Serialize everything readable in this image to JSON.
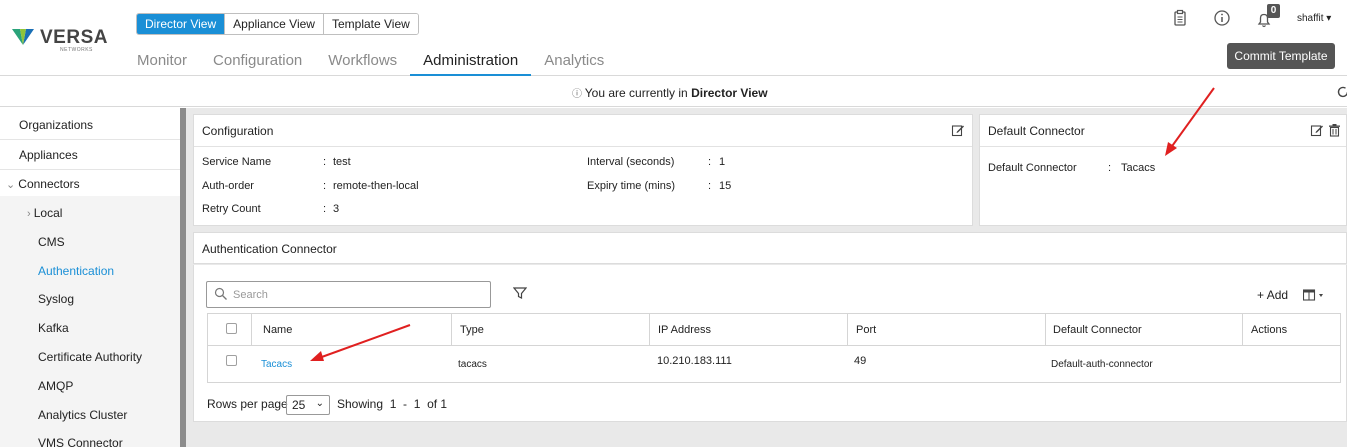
{
  "header": {
    "logo": {
      "brand": "VERSA",
      "sub": "NETWORKS"
    },
    "view_toggle": [
      "Director View",
      "Appliance View",
      "Template View"
    ],
    "active_view": "Director View",
    "nav": [
      "Monitor",
      "Configuration",
      "Workflows",
      "Administration",
      "Analytics"
    ],
    "active_nav": "Administration",
    "notification_count": "0",
    "user": "shaffit",
    "commit_button": "Commit Template",
    "icons": [
      "clipboard-icon",
      "info-icon",
      "bell-icon"
    ]
  },
  "banner": {
    "prefix": "You are currently in ",
    "view": "Director View"
  },
  "sidebar": {
    "items": [
      {
        "label": "Organizations"
      },
      {
        "label": "Appliances"
      },
      {
        "label": "Connectors",
        "expanded": true
      },
      {
        "label": "Local",
        "child": true,
        "collapsed": true
      },
      {
        "label": "CMS",
        "child": true
      },
      {
        "label": "Authentication",
        "child": true,
        "active": true
      },
      {
        "label": "Syslog",
        "child": true
      },
      {
        "label": "Kafka",
        "child": true
      },
      {
        "label": "Certificate Authority",
        "child": true
      },
      {
        "label": "AMQP",
        "child": true
      },
      {
        "label": "Analytics Cluster",
        "child": true
      },
      {
        "label": "VMS Connector",
        "child": true
      }
    ]
  },
  "configuration": {
    "title": "Configuration",
    "left": [
      {
        "label": "Service Name",
        "value": "test"
      },
      {
        "label": "Auth-order",
        "value": "remote-then-local"
      },
      {
        "label": "Retry Count",
        "value": "3"
      }
    ],
    "right": [
      {
        "label": "Interval (seconds)",
        "value": "1"
      },
      {
        "label": "Expiry time (mins)",
        "value": "15"
      }
    ]
  },
  "default_connector": {
    "title": "Default Connector",
    "label": "Default Connector",
    "value": "Tacacs"
  },
  "auth_connector": {
    "title": "Authentication Connector",
    "search_placeholder": "Search",
    "add_label": "Add",
    "columns": [
      "Name",
      "Type",
      "IP Address",
      "Port",
      "Default Connector",
      "Actions"
    ],
    "rows": [
      {
        "name": "Tacacs",
        "type": "tacacs",
        "ip": "10.210.183.111",
        "port": "49",
        "default_connector": "Default-auth-connector",
        "actions": ""
      }
    ],
    "pager": {
      "rows_per_page_label": "Rows per page",
      "rows_per_page": "25",
      "showing": "Showing",
      "from": "1",
      "to": "1",
      "of": "of 1"
    }
  },
  "colors": {
    "accent": "#1a8fd6",
    "annotation_arrow": "#e02020",
    "commit_bg": "#555555"
  }
}
